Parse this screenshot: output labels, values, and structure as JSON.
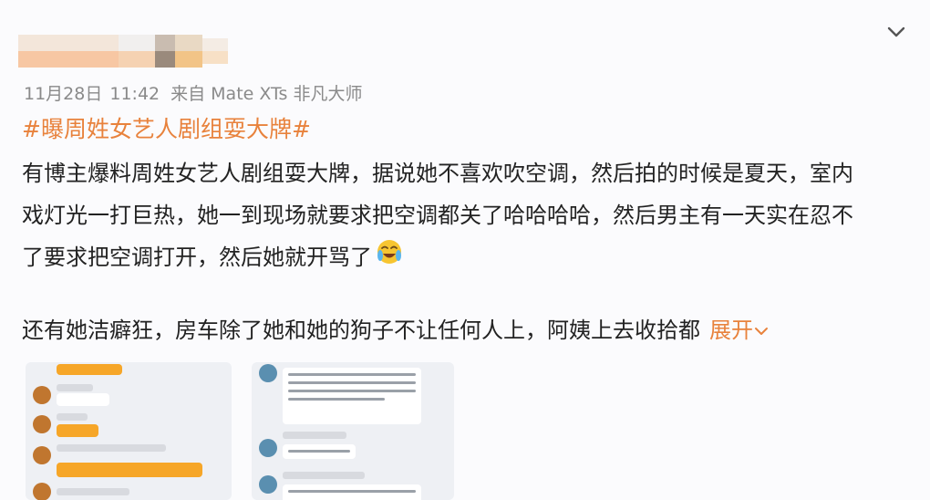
{
  "post": {
    "meta": {
      "date": "11月28日",
      "time": "11:42",
      "source": "来自 Mate XTs 非凡大师"
    },
    "topic": "#曝周姓女艺人剧组耍大牌#",
    "body_lines": [
      "有博主爆料周姓女艺人剧组耍大牌，据说她不喜欢吹空调，然后拍的时候是夏天，室内",
      "戏灯光一打巨热，她一到现场就要求把空调都关了哈哈哈哈，然后男主有一天实在忍不",
      "了要求把空调打开，然后她就开骂了"
    ],
    "paragraph2": "还有她洁癖狂，房车除了她和她的狗子不让任何人上，阿姨上去收拾都",
    "expand_label": "展开",
    "emoji_icon": "crying-laughing-emoji-icon",
    "menu_icon": "chevron-down-icon",
    "expand_icon": "chevron-down-small-icon"
  },
  "colors": {
    "accent": "#e8823c",
    "meta_gray": "#8a8a8a",
    "text": "#222222",
    "background": "#fbfbfd"
  }
}
